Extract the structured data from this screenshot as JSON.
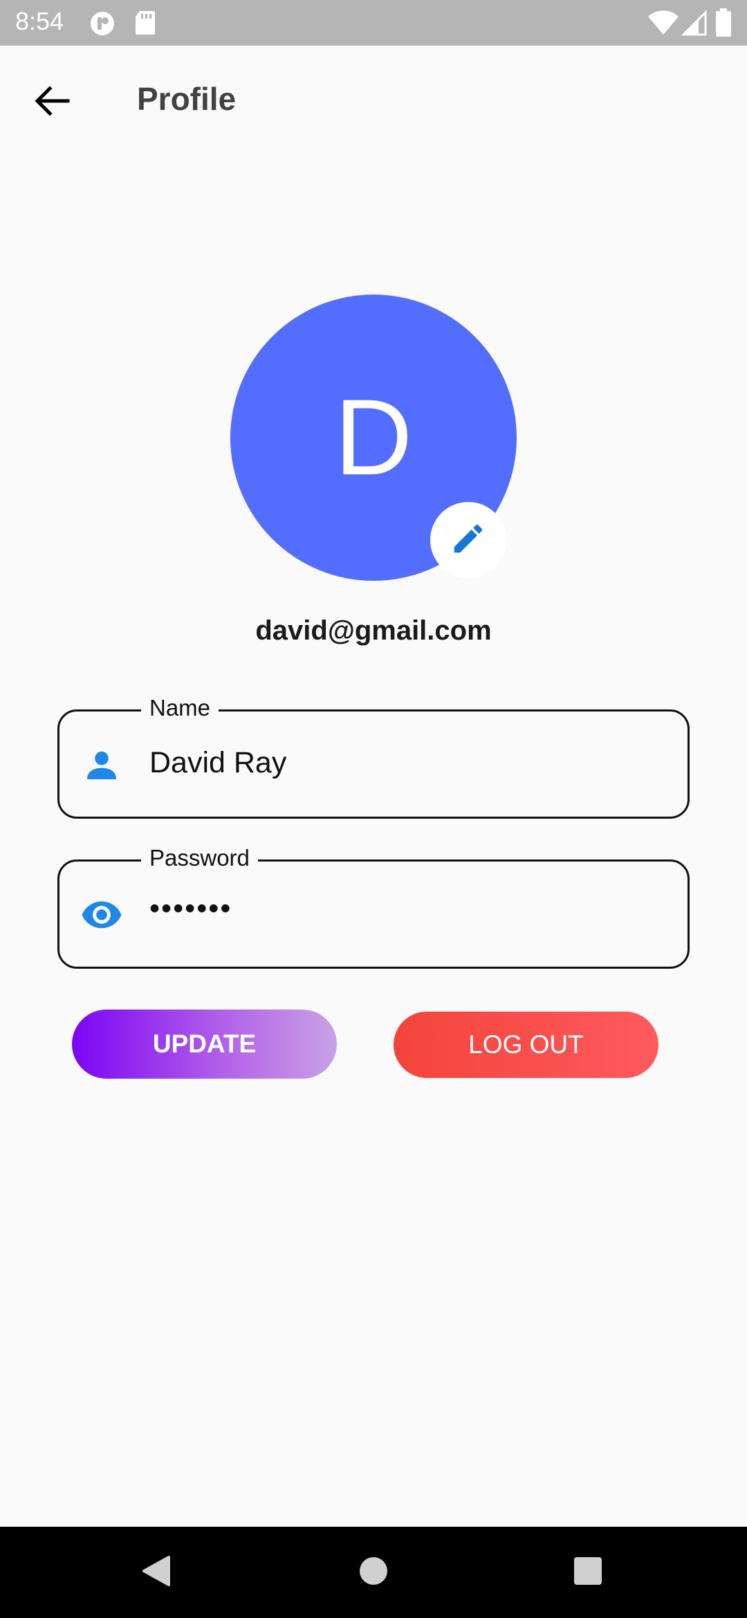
{
  "status_bar": {
    "time": "8:54",
    "icons": [
      "notification-icon",
      "sd-card-icon",
      "wifi-icon",
      "signal-icon",
      "battery-icon"
    ]
  },
  "app_bar": {
    "back_icon": "arrow-left-icon",
    "title": "Profile"
  },
  "profile": {
    "avatar_letter": "D",
    "avatar_color": "#536dfe",
    "edit_icon": "pencil-icon",
    "email": "david@gmail.com"
  },
  "form": {
    "name": {
      "label": "Name",
      "value": "David Ray",
      "icon": "person-icon"
    },
    "password": {
      "label": "Password",
      "value": "•••••••",
      "icon": "eye-icon"
    }
  },
  "actions": {
    "update_label": "UPDATE",
    "logout_label": "LOG OUT"
  },
  "colors": {
    "accent_blue": "#1e88e5",
    "update_gradient_start": "#7b05f4",
    "update_gradient_end": "#c8a2e6",
    "logout_red": "#f2443a"
  },
  "nav_bar": {
    "icons": [
      "back-triangle-icon",
      "home-circle-icon",
      "recents-square-icon"
    ]
  }
}
